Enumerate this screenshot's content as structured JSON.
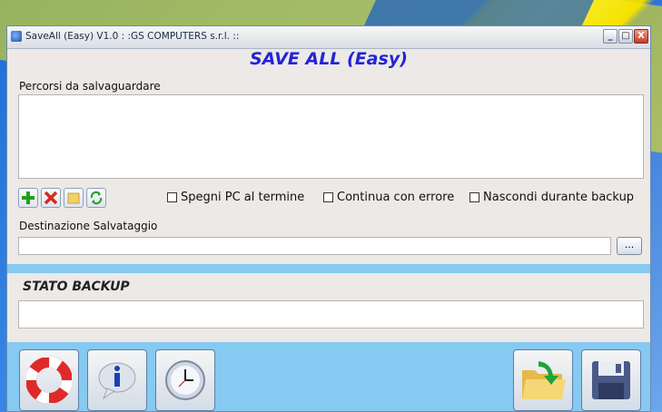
{
  "window": {
    "title": "SaveAll (Easy) V1.0  : :GS COMPUTERS s.r.l. ::"
  },
  "titlebar_buttons": {
    "minimize": "_",
    "maximize": "□",
    "close": "X"
  },
  "app": {
    "heading": "SAVE ALL (Easy)"
  },
  "paths": {
    "label": "Percorsi da salvaguardare",
    "items": []
  },
  "toolbar": {
    "icons": [
      "add-icon",
      "remove-icon",
      "folder-icon",
      "refresh-icon"
    ]
  },
  "options": [
    {
      "label": "Spegni PC al termine",
      "checked": false
    },
    {
      "label": "Continua con errore",
      "checked": false
    },
    {
      "label": "Nascondi durante backup",
      "checked": false
    }
  ],
  "destination": {
    "label": "Destinazione Salvataggio",
    "value": "",
    "browse_label": "..."
  },
  "status": {
    "label": "STATO BACKUP",
    "value": ""
  },
  "bottom_buttons": [
    "help-lifebuoy-icon",
    "info-icon",
    "clock-icon",
    "open-folder-icon",
    "save-disk-icon"
  ],
  "colors": {
    "heading": "#2323d8",
    "band": "#86c9f1",
    "add": "#21a01e",
    "remove": "#d52a1c"
  }
}
